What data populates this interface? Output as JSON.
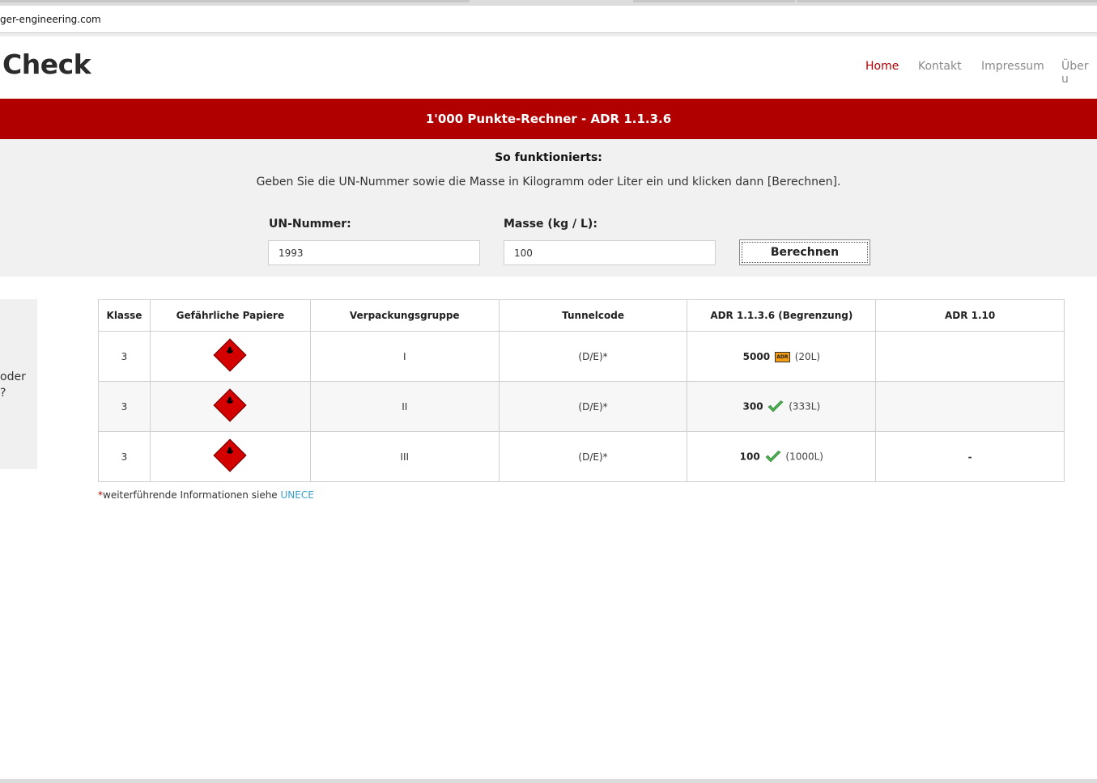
{
  "browser": {
    "url": "ger-engineering.com"
  },
  "site": {
    "brand": "Check",
    "nav": [
      {
        "label": "Home",
        "active": true
      },
      {
        "label": "Kontakt",
        "active": false
      },
      {
        "label": "Impressum",
        "active": false
      },
      {
        "label": "Über u",
        "active": false
      }
    ]
  },
  "banner": {
    "title": "1'000 Punkte-Rechner - ADR 1.1.3.6"
  },
  "form": {
    "howto_title": "So funktionierts:",
    "instructions": "Geben Sie die UN-Nummer sowie die Masse in Kilogramm oder Liter ein und klicken dann [Berechnen].",
    "un_label": "UN-Nummer:",
    "un_value": "1993",
    "mass_label": "Masse (kg / L):",
    "mass_value": "100",
    "submit_label": "Berechnen"
  },
  "sidebar": {
    "line1": "oder",
    "line2": "?"
  },
  "table": {
    "headers": [
      "Klasse",
      "Gefährliche Papiere",
      "Verpackungsgruppe",
      "Tunnelcode",
      "ADR 1.1.3.6 (Begrenzung)",
      "ADR 1.10"
    ],
    "rows": [
      {
        "klasse": "3",
        "hazard_icon": "flammable-liquid-class3-diamond-icon",
        "gruppe": "I",
        "tunnel": "(D/E)*",
        "limit_value": "5000",
        "limit_icon": "adr-orange-plate-icon",
        "limit_volume": "(20L)",
        "adr110": ""
      },
      {
        "klasse": "3",
        "hazard_icon": "flammable-liquid-class3-diamond-icon",
        "gruppe": "II",
        "tunnel": "(D/E)*",
        "limit_value": "300",
        "limit_icon": "green-check-icon",
        "limit_volume": "(333L)",
        "adr110": ""
      },
      {
        "klasse": "3",
        "hazard_icon": "flammable-liquid-class3-diamond-icon",
        "gruppe": "III",
        "tunnel": "(D/E)*",
        "limit_value": "100",
        "limit_icon": "green-check-icon",
        "limit_volume": "(1000L)",
        "adr110": "-"
      }
    ],
    "adr_badge_text": "ADR"
  },
  "footnote": {
    "star": "*",
    "text": "weiterführende Informationen siehe ",
    "link": "UNECE"
  },
  "colors": {
    "brand_red": "#b00000",
    "panel_gray": "#f1f1f1",
    "link_blue": "#3aa0d0",
    "check_green": "#4caf50",
    "adr_orange": "#f39c12"
  }
}
